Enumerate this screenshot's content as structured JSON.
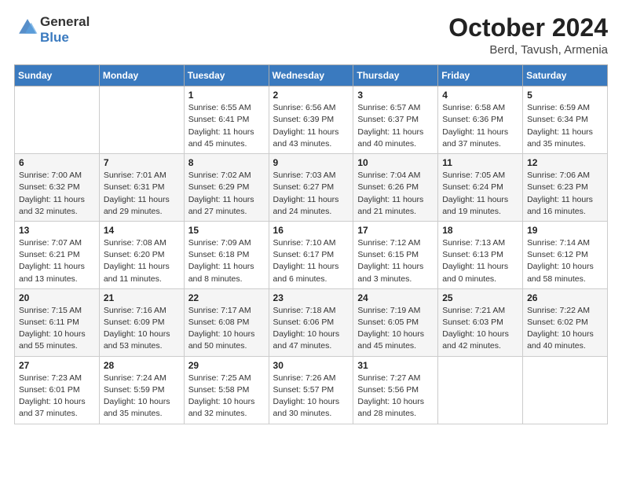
{
  "header": {
    "logo_line1": "General",
    "logo_line2": "Blue",
    "title": "October 2024",
    "subtitle": "Berd, Tavush, Armenia"
  },
  "weekdays": [
    "Sunday",
    "Monday",
    "Tuesday",
    "Wednesday",
    "Thursday",
    "Friday",
    "Saturday"
  ],
  "weeks": [
    [
      {
        "day": "",
        "info": ""
      },
      {
        "day": "",
        "info": ""
      },
      {
        "day": "1",
        "info": "Sunrise: 6:55 AM\nSunset: 6:41 PM\nDaylight: 11 hours and 45 minutes."
      },
      {
        "day": "2",
        "info": "Sunrise: 6:56 AM\nSunset: 6:39 PM\nDaylight: 11 hours and 43 minutes."
      },
      {
        "day": "3",
        "info": "Sunrise: 6:57 AM\nSunset: 6:37 PM\nDaylight: 11 hours and 40 minutes."
      },
      {
        "day": "4",
        "info": "Sunrise: 6:58 AM\nSunset: 6:36 PM\nDaylight: 11 hours and 37 minutes."
      },
      {
        "day": "5",
        "info": "Sunrise: 6:59 AM\nSunset: 6:34 PM\nDaylight: 11 hours and 35 minutes."
      }
    ],
    [
      {
        "day": "6",
        "info": "Sunrise: 7:00 AM\nSunset: 6:32 PM\nDaylight: 11 hours and 32 minutes."
      },
      {
        "day": "7",
        "info": "Sunrise: 7:01 AM\nSunset: 6:31 PM\nDaylight: 11 hours and 29 minutes."
      },
      {
        "day": "8",
        "info": "Sunrise: 7:02 AM\nSunset: 6:29 PM\nDaylight: 11 hours and 27 minutes."
      },
      {
        "day": "9",
        "info": "Sunrise: 7:03 AM\nSunset: 6:27 PM\nDaylight: 11 hours and 24 minutes."
      },
      {
        "day": "10",
        "info": "Sunrise: 7:04 AM\nSunset: 6:26 PM\nDaylight: 11 hours and 21 minutes."
      },
      {
        "day": "11",
        "info": "Sunrise: 7:05 AM\nSunset: 6:24 PM\nDaylight: 11 hours and 19 minutes."
      },
      {
        "day": "12",
        "info": "Sunrise: 7:06 AM\nSunset: 6:23 PM\nDaylight: 11 hours and 16 minutes."
      }
    ],
    [
      {
        "day": "13",
        "info": "Sunrise: 7:07 AM\nSunset: 6:21 PM\nDaylight: 11 hours and 13 minutes."
      },
      {
        "day": "14",
        "info": "Sunrise: 7:08 AM\nSunset: 6:20 PM\nDaylight: 11 hours and 11 minutes."
      },
      {
        "day": "15",
        "info": "Sunrise: 7:09 AM\nSunset: 6:18 PM\nDaylight: 11 hours and 8 minutes."
      },
      {
        "day": "16",
        "info": "Sunrise: 7:10 AM\nSunset: 6:17 PM\nDaylight: 11 hours and 6 minutes."
      },
      {
        "day": "17",
        "info": "Sunrise: 7:12 AM\nSunset: 6:15 PM\nDaylight: 11 hours and 3 minutes."
      },
      {
        "day": "18",
        "info": "Sunrise: 7:13 AM\nSunset: 6:13 PM\nDaylight: 11 hours and 0 minutes."
      },
      {
        "day": "19",
        "info": "Sunrise: 7:14 AM\nSunset: 6:12 PM\nDaylight: 10 hours and 58 minutes."
      }
    ],
    [
      {
        "day": "20",
        "info": "Sunrise: 7:15 AM\nSunset: 6:11 PM\nDaylight: 10 hours and 55 minutes."
      },
      {
        "day": "21",
        "info": "Sunrise: 7:16 AM\nSunset: 6:09 PM\nDaylight: 10 hours and 53 minutes."
      },
      {
        "day": "22",
        "info": "Sunrise: 7:17 AM\nSunset: 6:08 PM\nDaylight: 10 hours and 50 minutes."
      },
      {
        "day": "23",
        "info": "Sunrise: 7:18 AM\nSunset: 6:06 PM\nDaylight: 10 hours and 47 minutes."
      },
      {
        "day": "24",
        "info": "Sunrise: 7:19 AM\nSunset: 6:05 PM\nDaylight: 10 hours and 45 minutes."
      },
      {
        "day": "25",
        "info": "Sunrise: 7:21 AM\nSunset: 6:03 PM\nDaylight: 10 hours and 42 minutes."
      },
      {
        "day": "26",
        "info": "Sunrise: 7:22 AM\nSunset: 6:02 PM\nDaylight: 10 hours and 40 minutes."
      }
    ],
    [
      {
        "day": "27",
        "info": "Sunrise: 7:23 AM\nSunset: 6:01 PM\nDaylight: 10 hours and 37 minutes."
      },
      {
        "day": "28",
        "info": "Sunrise: 7:24 AM\nSunset: 5:59 PM\nDaylight: 10 hours and 35 minutes."
      },
      {
        "day": "29",
        "info": "Sunrise: 7:25 AM\nSunset: 5:58 PM\nDaylight: 10 hours and 32 minutes."
      },
      {
        "day": "30",
        "info": "Sunrise: 7:26 AM\nSunset: 5:57 PM\nDaylight: 10 hours and 30 minutes."
      },
      {
        "day": "31",
        "info": "Sunrise: 7:27 AM\nSunset: 5:56 PM\nDaylight: 10 hours and 28 minutes."
      },
      {
        "day": "",
        "info": ""
      },
      {
        "day": "",
        "info": ""
      }
    ]
  ]
}
